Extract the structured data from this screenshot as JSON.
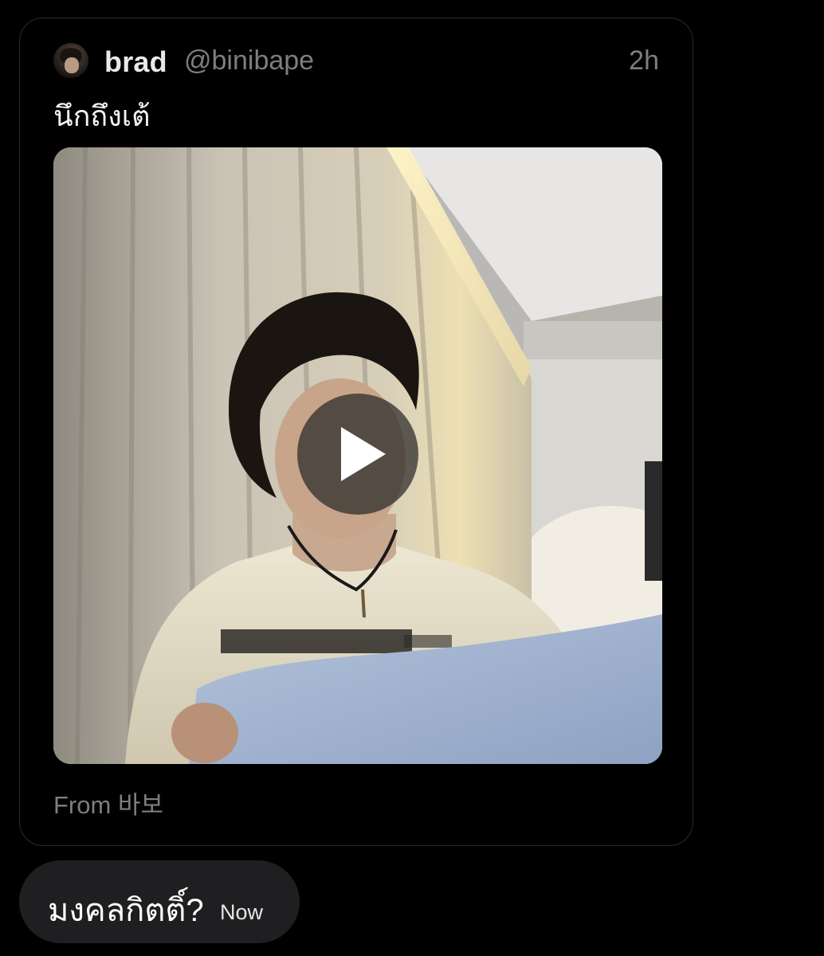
{
  "tweet": {
    "author_name": "brad",
    "author_handle": "@binibape",
    "timestamp": "2h",
    "text": "นึกถึงเต้",
    "media": {
      "type": "video",
      "play_icon": "play-icon"
    },
    "source": "From 바보"
  },
  "reply": {
    "text": "มงคลกิตติ์?",
    "time": "Now"
  }
}
